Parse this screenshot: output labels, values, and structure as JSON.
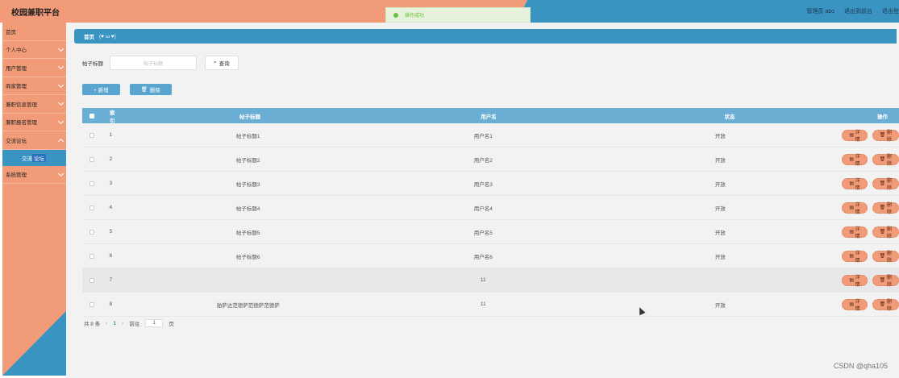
{
  "header": {
    "brand": "校园兼职平台",
    "toast": "操作成功",
    "links": [
      "管理员 abo",
      "退出到前台",
      "退出登"
    ]
  },
  "sidebar": {
    "items": [
      {
        "label": "首页",
        "chevron": false
      },
      {
        "label": "个人中心",
        "chevron": true
      },
      {
        "label": "用户管理",
        "chevron": true
      },
      {
        "label": "商家管理",
        "chevron": true
      },
      {
        "label": "兼职信息管理",
        "chevron": true
      },
      {
        "label": "兼职报名管理",
        "chevron": true
      },
      {
        "label": "交流论坛",
        "chevron": true
      }
    ],
    "sub_active_a": "交流",
    "sub_active_b": "论坛",
    "bottom_item": "系统管理"
  },
  "breadcrumb": {
    "home": "首页",
    "sub": "(♥ ω ♥)"
  },
  "search": {
    "label": "帖子标题",
    "placeholder": "帖子标题",
    "button": "查询"
  },
  "actions": {
    "add": "+ 新增",
    "delete": "删除"
  },
  "table": {
    "headers": {
      "index": "索引",
      "title": "帖子标题",
      "user": "用户名",
      "status": "状态",
      "ops": "操作"
    },
    "rows": [
      {
        "index": "1",
        "title": "帖子标题1",
        "user": "用户名1",
        "status": "开放"
      },
      {
        "index": "2",
        "title": "帖子标题2",
        "user": "用户名2",
        "status": "开放"
      },
      {
        "index": "3",
        "title": "帖子标题3",
        "user": "用户名3",
        "status": "开放"
      },
      {
        "index": "4",
        "title": "帖子标题4",
        "user": "用户名4",
        "status": "开放"
      },
      {
        "index": "5",
        "title": "帖子标题5",
        "user": "用户名5",
        "status": "开放"
      },
      {
        "index": "6",
        "title": "帖子标题6",
        "user": "用户名6",
        "status": "开放"
      },
      {
        "index": "7",
        "title": "",
        "user": "11",
        "status": ""
      },
      {
        "index": "8",
        "title": "舶萨达范德萨范德萨范德萨",
        "user": "11",
        "status": "开放"
      }
    ],
    "row_actions": {
      "detail": "详情",
      "delete": "删除"
    }
  },
  "pager": {
    "total": "共 8 条",
    "prev": "‹",
    "page": "1",
    "next": "›",
    "goto": "前往",
    "goto_value": "1",
    "page_suffix": "页"
  },
  "watermark": "CSDN @qha105",
  "colors": {
    "orange": "#f29b78",
    "blue": "#3a94c2"
  }
}
